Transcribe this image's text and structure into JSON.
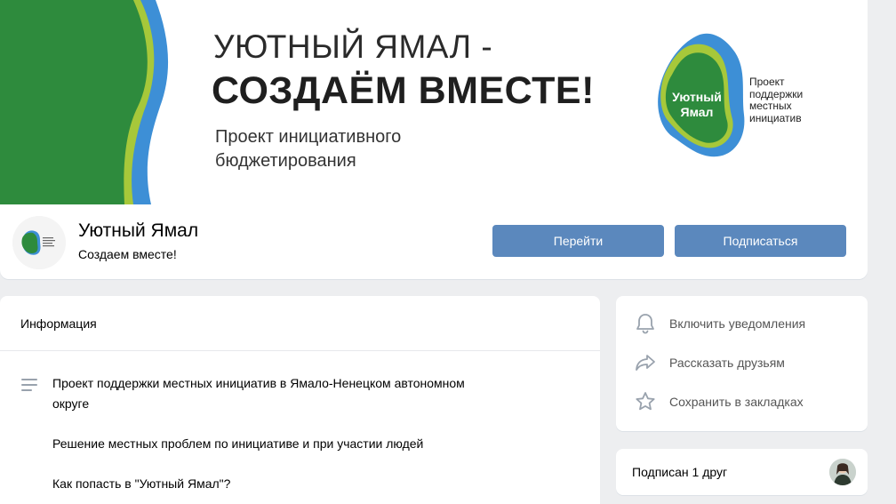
{
  "cover": {
    "title_line1": "УЮТНЫЙ ЯМАЛ -",
    "title_line2": "СОЗДАЁМ ВМЕСТЕ!",
    "subtitle_line1": "Проект инициативного",
    "subtitle_line2": "бюджетирования",
    "logo_text_line1": "Уютный",
    "logo_text_line2": "Ямал",
    "logo_caption_line1": "Проект",
    "logo_caption_line2": "поддержки",
    "logo_caption_line3": "местных",
    "logo_caption_line4": "инициатив",
    "colors": {
      "green": "#2e8b3d",
      "lime": "#a7c83a",
      "blue": "#3d8fd6"
    }
  },
  "profile": {
    "name": "Уютный Ямал",
    "status": "Создаем вместе!",
    "avatar_text": "Уютный Ямал"
  },
  "buttons": {
    "go_label": "Перейти",
    "subscribe_label": "Подписаться",
    "color": "#5b88bd"
  },
  "info": {
    "header": "Информация",
    "icon": "menu-lines-icon",
    "lines": [
      "Проект поддержки местных инициатив в Ямало-Ненецком автономном",
      "округе",
      "Решение местных проблем по инициативе и при участии людей",
      "Как попасть в \"Уютный Ямал\"?"
    ]
  },
  "actions": [
    {
      "label": "Включить уведомления",
      "icon": "bell-icon"
    },
    {
      "label": "Рассказать друзьям",
      "icon": "share-arrow-icon"
    },
    {
      "label": "Сохранить в закладках",
      "icon": "star-icon"
    }
  ],
  "friends": {
    "label": "Подписан 1 друг"
  }
}
